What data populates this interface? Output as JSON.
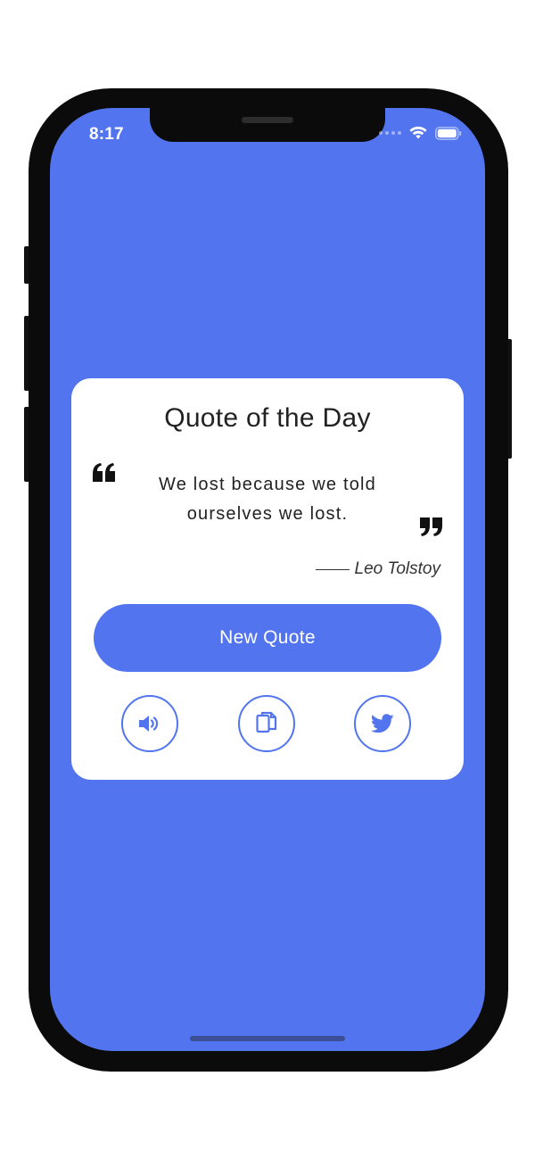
{
  "status_bar": {
    "time": "8:17"
  },
  "card": {
    "title": "Quote of the Day",
    "quote": "We lost because we told ourselves we lost.",
    "author_dash": "——",
    "author": "Leo Tolstoy",
    "new_quote_label": "New Quote"
  },
  "actions": [
    {
      "name": "speaker-icon"
    },
    {
      "name": "copy-icon"
    },
    {
      "name": "twitter-icon"
    }
  ],
  "colors": {
    "accent": "#5275EF",
    "card_bg": "#FFFFFF",
    "text": "#222222"
  }
}
